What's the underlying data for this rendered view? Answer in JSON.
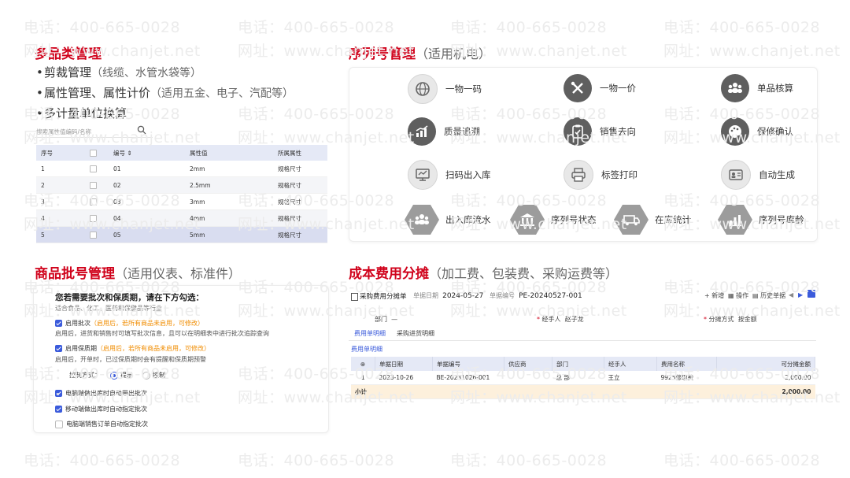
{
  "watermark": {
    "phone": "电话：400-665-0028",
    "site": "网址：www.chanjet.net"
  },
  "multi_category": {
    "title": "多品类管理",
    "bullets": [
      {
        "main": "剪裁管理",
        "note": "（线缆、水管水袋等）"
      },
      {
        "main": "属性管理、属性计价",
        "note": "（适用五金、电子、汽配等）"
      },
      {
        "main": "多计量单位换算",
        "note": ""
      }
    ],
    "search_placeholder": "搜索属性值编码/名称",
    "table": {
      "headers": [
        "序号",
        "",
        "编号 ⇕",
        "属性值",
        "所属属性"
      ],
      "rows": [
        [
          "1",
          "01",
          "2mm",
          "规格尺寸"
        ],
        [
          "2",
          "02",
          "2.5mm",
          "规格尺寸"
        ],
        [
          "3",
          "03",
          "3mm",
          "规格尺寸"
        ],
        [
          "4",
          "04",
          "4mm",
          "规格尺寸"
        ],
        [
          "5",
          "05",
          "5mm",
          "规格尺寸"
        ]
      ]
    }
  },
  "serial": {
    "title": "序列号管理",
    "subtitle": "（适用机电）",
    "items": [
      {
        "label": "一物一码",
        "icon": "globe-icon"
      },
      {
        "label": "一物一价",
        "icon": "tools-icon"
      },
      {
        "label": "单品核算",
        "icon": "users-icon"
      },
      {
        "label": "质量追溯",
        "icon": "chart-up-icon"
      },
      {
        "label": "销售去向",
        "icon": "clipboard-icon"
      },
      {
        "label": "保修确认",
        "icon": "palette-icon"
      },
      {
        "label": "扫码出入库",
        "icon": "monitor-icon"
      },
      {
        "label": "标签打印",
        "icon": "printer-icon"
      },
      {
        "label": "自动生成",
        "icon": "id-card-icon"
      },
      {
        "label": "出入库流水",
        "icon": "people-icon"
      },
      {
        "label": "序列号状态",
        "icon": "bank-icon"
      },
      {
        "label": "在库统计",
        "icon": "truck-icon"
      },
      {
        "label": "序列号库龄",
        "icon": "bar-chart-icon"
      }
    ]
  },
  "batch": {
    "title": "商品批号管理",
    "subtitle": "（适用仪表、标准件）",
    "heading": "您若需要批次和保质期，请在下方勾选：",
    "heading_sub": "适合食品、化工、医药和保健品等行业",
    "enable_batch": "启用批次",
    "enable_batch_note": "（启用后，若所有商品未启用，可修改）",
    "batch_desc": "启用后，进货和销售时可填写批次信息，且可以在明细表中进行批次追踪查询",
    "enable_shelf": "启用保质期",
    "enable_shelf_note": "（启用后，若所有商品未启用，可修改）",
    "shelf_desc": "启用后，开单时，已过保质期时会有提醒和保质期预警",
    "control_label": "控制方式：",
    "control_opt1": "提示",
    "control_opt2": "控制",
    "opt_pc_out": "电脑端做出库时自动带出批次",
    "opt_mobile_out": "移动端做出库时自动指定批次",
    "opt_pc_sales": "电脑端销售订单自动指定批次"
  },
  "cost": {
    "title": "成本费用分摊",
    "subtitle": "（加工费、包装费、采购运费等）",
    "doc_name": "采购费用分摊单",
    "date_label": "单据日期",
    "date_value": "2024-05-27",
    "no_label": "单据编号",
    "no_value": "PE-20240527-001",
    "btn_new": "新增",
    "btn_ops": "操作",
    "btn_history": "历史单据",
    "dept_label": "部门",
    "dept_value": "—",
    "handler_label": "经手人",
    "handler_value": "赵子龙",
    "method_label": "分摊方式",
    "method_value": "按金额",
    "tab1": "费用单明细",
    "tab2": "采购进货明细",
    "section_label": "费用单明细",
    "table": {
      "headers": [
        "⊕",
        "单据日期",
        "单据编号",
        "供应商",
        "部门",
        "经手人",
        "费用名称",
        "可分摊金额"
      ],
      "row": [
        "1",
        "2023-10-26",
        "BE-20231026-001",
        "",
        "总 部",
        "王立",
        "9925修理费",
        "2,000.00"
      ],
      "sum_label": "小计",
      "sum_value": "2,000.00"
    }
  }
}
